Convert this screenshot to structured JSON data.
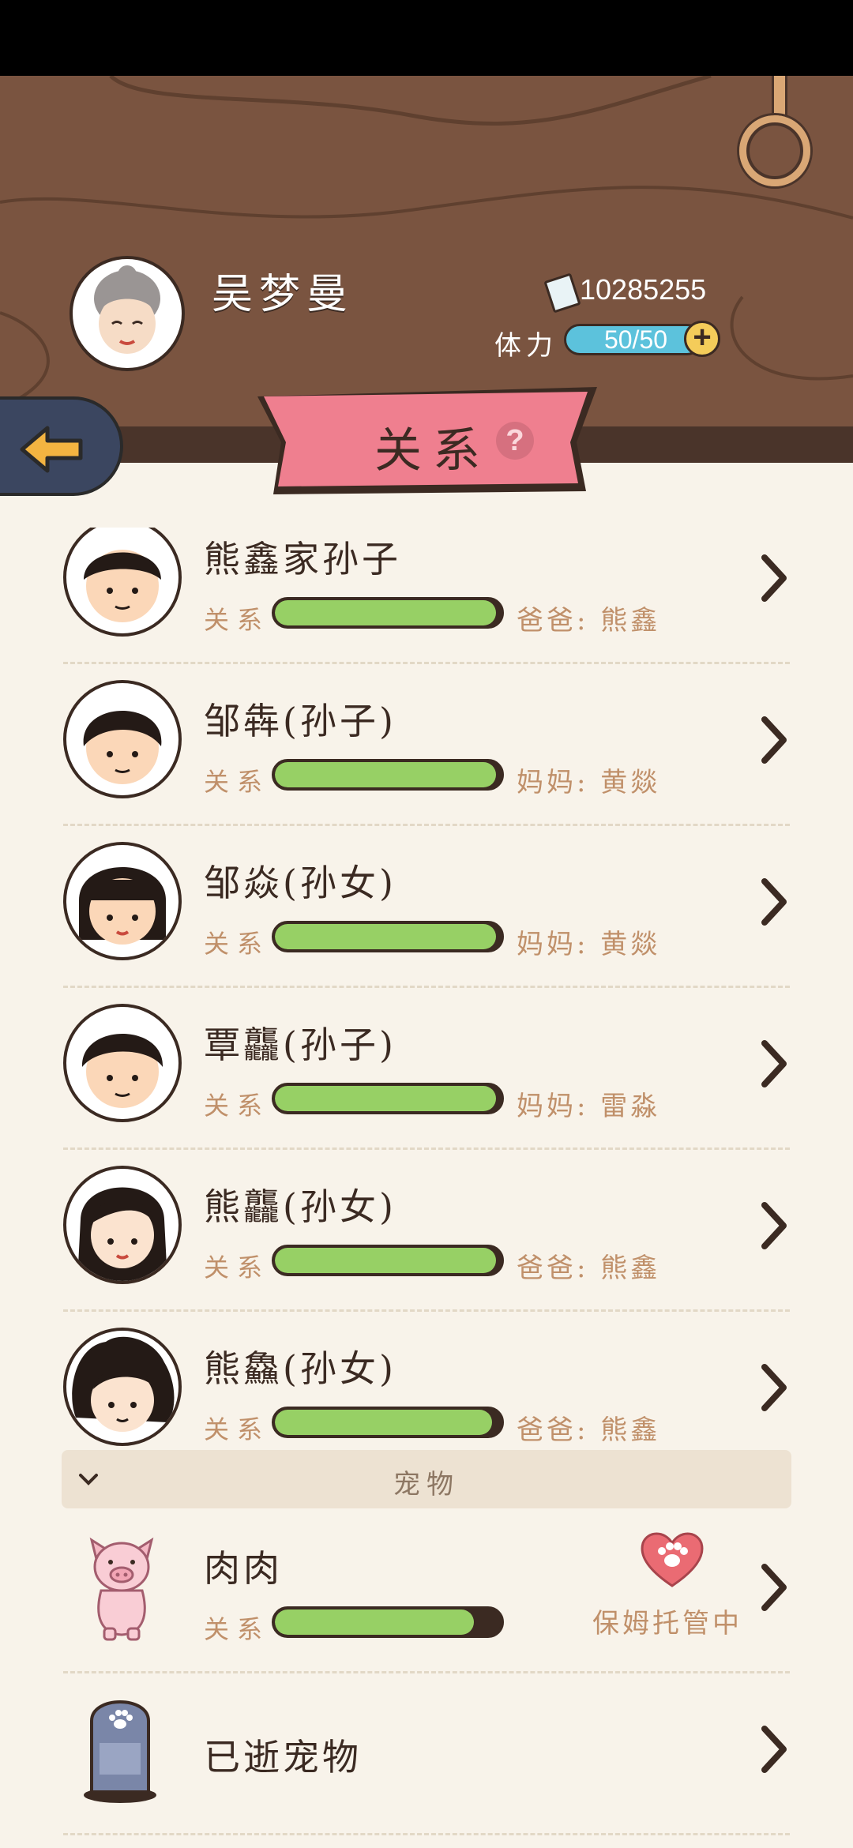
{
  "player": {
    "name": "吴梦曼",
    "money": "10285255",
    "stamina_label": "体力",
    "stamina_value": "50/50",
    "stamina_fraction": 1.0
  },
  "banner": {
    "title": "关系",
    "help": "?"
  },
  "family": [
    {
      "name": "熊鑫家孙子",
      "relation_label": "关系",
      "relation_level": 0.98,
      "parent": "爸爸: 熊鑫",
      "avatar": "boy-avatar"
    },
    {
      "name": "邹犇(孙子)",
      "relation_label": "关系",
      "relation_level": 0.98,
      "parent": "妈妈: 黄燚",
      "avatar": "boy-avatar"
    },
    {
      "name": "邹焱(孙女)",
      "relation_label": "关系",
      "relation_level": 0.98,
      "parent": "妈妈: 黄燚",
      "avatar": "girl-bob-avatar"
    },
    {
      "name": "覃龘(孙子)",
      "relation_label": "关系",
      "relation_level": 0.98,
      "parent": "妈妈: 雷淼",
      "avatar": "boy-avatar"
    },
    {
      "name": "熊龘(孙女)",
      "relation_label": "关系",
      "relation_level": 0.98,
      "parent": "爸爸: 熊鑫",
      "avatar": "girl-long-hair-avatar"
    },
    {
      "name": "熊鱻(孙女)",
      "relation_label": "关系",
      "relation_level": 0.96,
      "parent": "爸爸: 熊鑫",
      "avatar": "girl-curly-avatar"
    }
  ],
  "pets_section": {
    "title": "宠物"
  },
  "pets": [
    {
      "name": "肉肉",
      "relation_label": "关系",
      "relation_level": 0.88,
      "status": "保姆托管中",
      "icon": "pig-icon"
    }
  ],
  "deceased_pets": {
    "label": "已逝宠物",
    "icon": "tombstone-icon"
  },
  "colors": {
    "header_wood": "#7a5440",
    "page_bg": "#f8f3ea",
    "bar_fill": "#97d065",
    "banner_pink": "#ef7f8f",
    "back_button": "#3b4660",
    "stamina_blue": "#5cc2dc"
  }
}
